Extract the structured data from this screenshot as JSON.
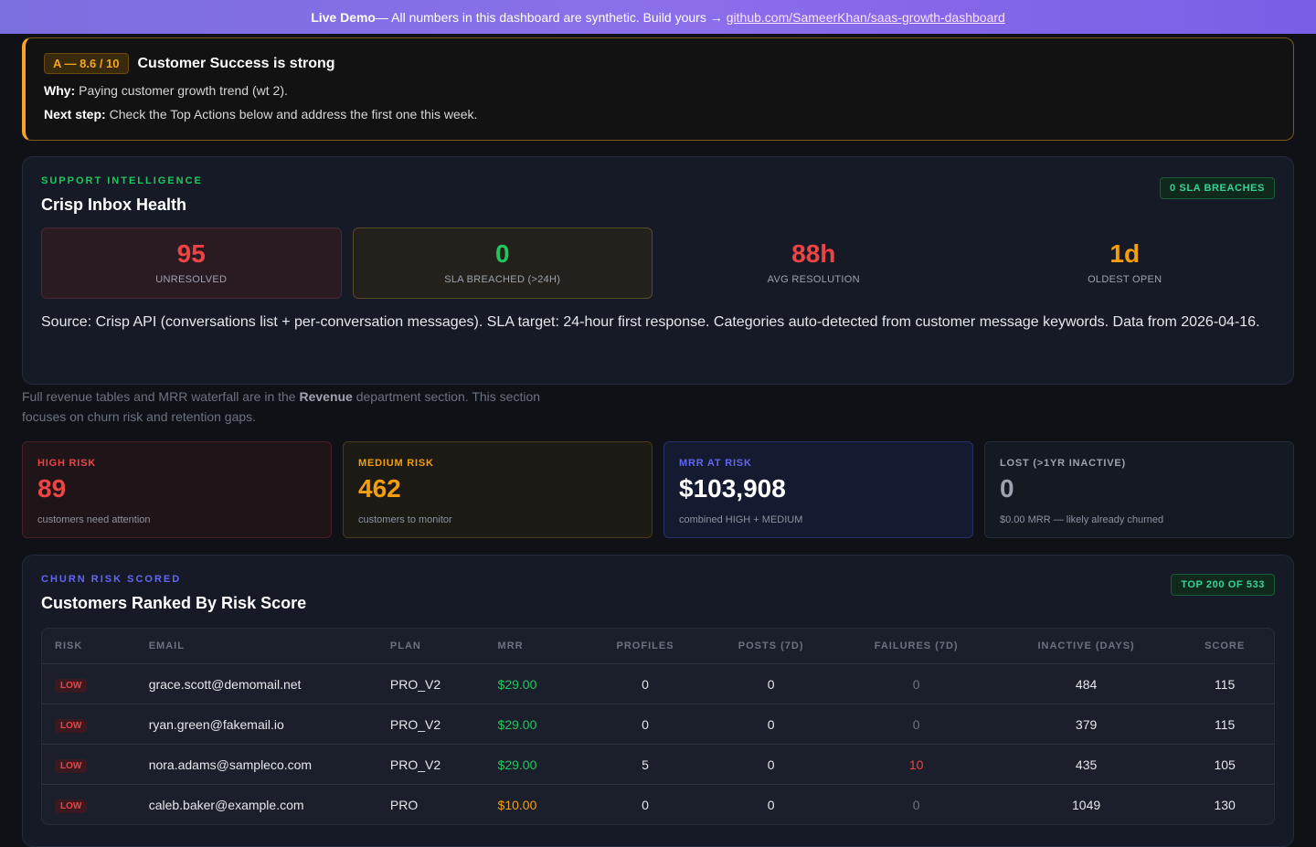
{
  "banner": {
    "strong": "Live Demo",
    "text": " — All numbers in this dashboard are synthetic. Build yours →",
    "link": "github.com/SameerKhan/saas-growth-dashboard"
  },
  "verdict": {
    "grade": "A — 8.6 / 10",
    "title": "Customer Success is strong",
    "why_label": "Why:",
    "why_text": " Paying customer growth trend (wt 2).",
    "next_label": "Next step:",
    "next_text": " Check the Top Actions below and address the first one this week."
  },
  "support": {
    "eyebrow": "SUPPORT INTELLIGENCE",
    "title": "Crisp Inbox Health",
    "pill": "0 SLA BREACHES",
    "stats": [
      {
        "value": "95",
        "label": "UNRESOLVED",
        "color": "#ef4444"
      },
      {
        "value": "0",
        "label": "SLA BREACHED (>24H)",
        "color": "#22c55e"
      },
      {
        "value": "88h",
        "label": "AVG RESOLUTION",
        "color": "#ef4444"
      },
      {
        "value": "1d",
        "label": "OLDEST OPEN",
        "color": "#f59e0b"
      }
    ],
    "source": "Source: Crisp API (conversations list + per-conversation messages). SLA target: 24-hour first response. Categories auto-detected from customer message keywords. Data from 2026-04-16."
  },
  "note": {
    "before": "Full revenue tables and MRR waterfall are in the ",
    "bold": "Revenue",
    "after": " department section. This section focuses on churn risk and retention gaps."
  },
  "kpis": [
    {
      "label": "HIGH RISK",
      "value": "89",
      "sub": "customers need attention",
      "label_color": "#ef4444",
      "value_color": "#ef4444"
    },
    {
      "label": "MEDIUM RISK",
      "value": "462",
      "sub": "customers to monitor",
      "label_color": "#f59e0b",
      "value_color": "#f59e0b"
    },
    {
      "label": "MRR AT RISK",
      "value": "$103,908",
      "sub": "combined HIGH + MEDIUM",
      "label_color": "#6366f1",
      "value_color": "#ffffff"
    },
    {
      "label": "LOST (>1YR INACTIVE)",
      "value": "0",
      "sub": "$0.00 MRR — likely already churned",
      "label_color": "#9ca3af",
      "value_color": "#9ca3af"
    }
  ],
  "churn": {
    "eyebrow": "CHURN RISK SCORED",
    "title": "Customers Ranked By Risk Score",
    "pill": "TOP 200 OF 533",
    "columns": [
      "RISK",
      "EMAIL",
      "PLAN",
      "MRR",
      "PROFILES",
      "POSTS (7D)",
      "FAILURES (7D)",
      "INACTIVE (DAYS)",
      "SCORE"
    ],
    "rows": [
      {
        "risk": "LOW",
        "email": "grace.scott@demomail.net",
        "plan": "PRO_V2",
        "mrr": "$29.00",
        "mrr_tone": "green",
        "profiles": "0",
        "posts": "0",
        "failures": "0",
        "fail_tone": "muted",
        "inactive": "484",
        "score": "115"
      },
      {
        "risk": "LOW",
        "email": "ryan.green@fakemail.io",
        "plan": "PRO_V2",
        "mrr": "$29.00",
        "mrr_tone": "green",
        "profiles": "0",
        "posts": "0",
        "failures": "0",
        "fail_tone": "muted",
        "inactive": "379",
        "score": "115"
      },
      {
        "risk": "LOW",
        "email": "nora.adams@sampleco.com",
        "plan": "PRO_V2",
        "mrr": "$29.00",
        "mrr_tone": "green",
        "profiles": "5",
        "posts": "0",
        "failures": "10",
        "fail_tone": "red",
        "inactive": "435",
        "score": "105"
      },
      {
        "risk": "LOW",
        "email": "caleb.baker@example.com",
        "plan": "PRO",
        "mrr": "$10.00",
        "mrr_tone": "amber",
        "profiles": "0",
        "posts": "0",
        "failures": "0",
        "fail_tone": "muted",
        "inactive": "1049",
        "score": "130"
      }
    ]
  }
}
